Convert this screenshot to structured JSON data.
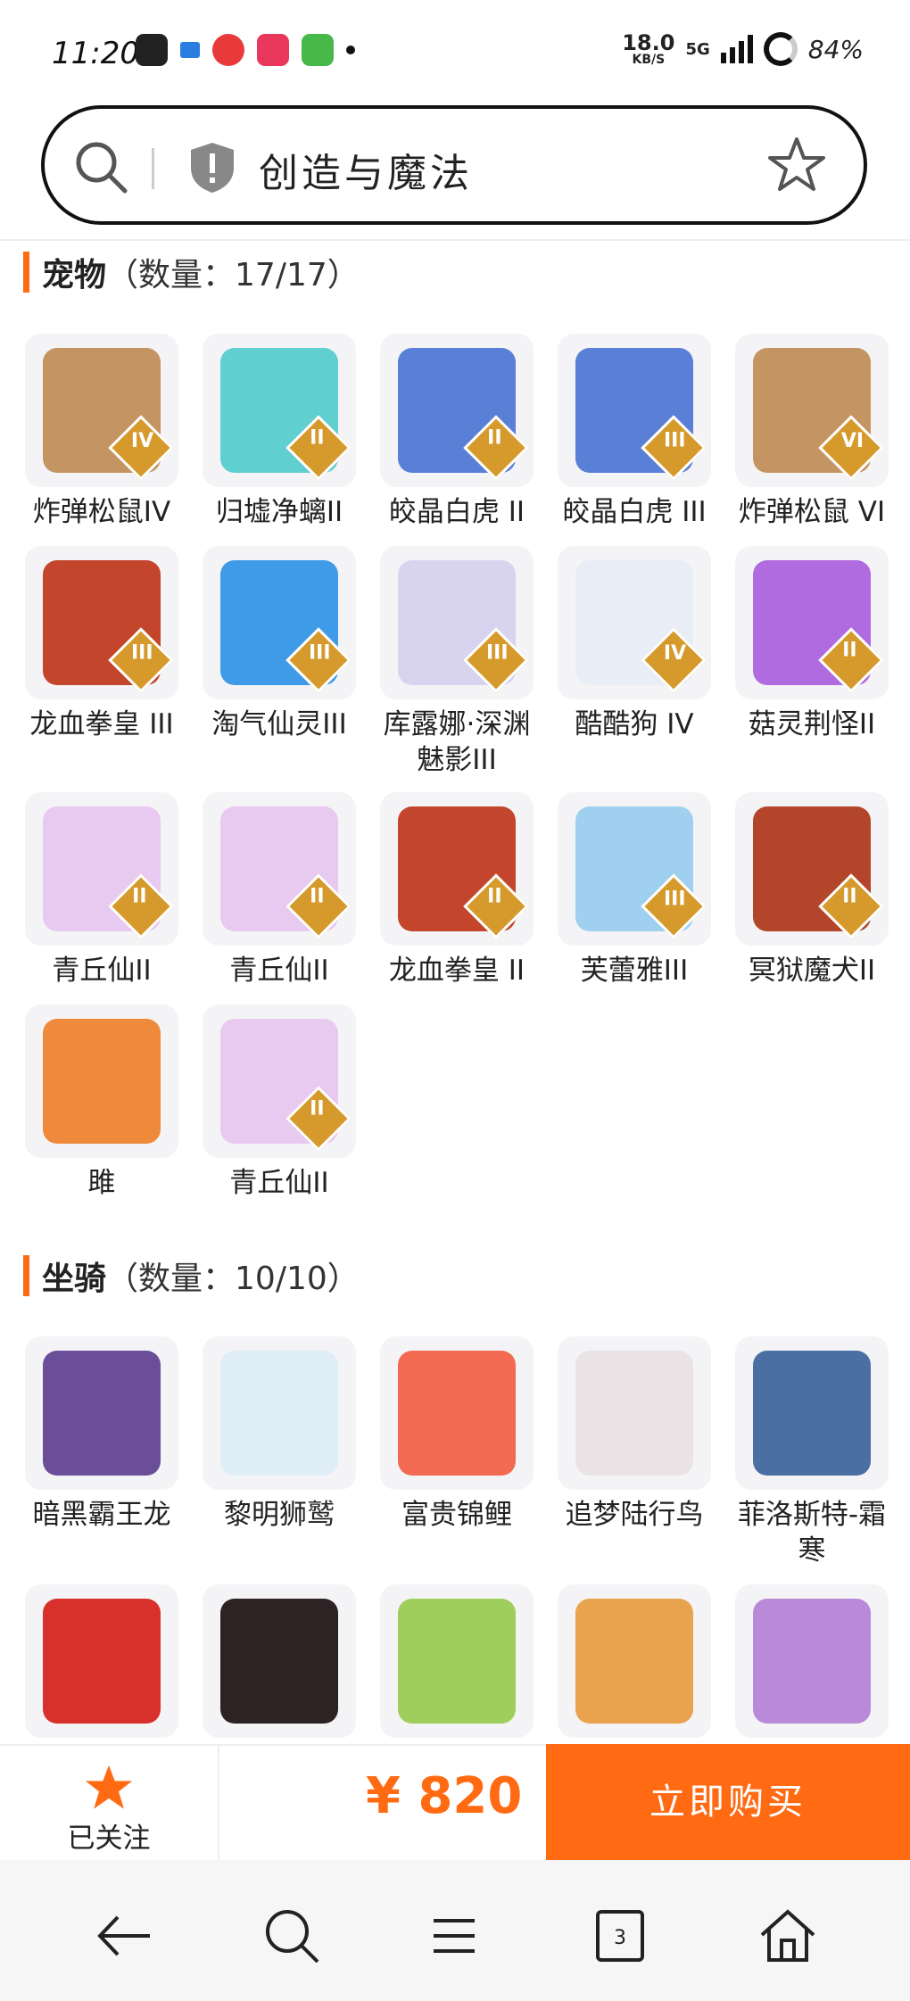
{
  "status_bar": {
    "time": "11:20",
    "speed_value": "18.0",
    "speed_unit": "KB/S",
    "network": "5G",
    "battery": "84%"
  },
  "search": {
    "query": "创造与魔法"
  },
  "pets_section": {
    "title": "宠物",
    "count": "（数量：17/17）",
    "items": [
      {
        "label": "炸弹松鼠IV",
        "badge": "IV",
        "color": "#c59463"
      },
      {
        "label": "归墟净螭II",
        "badge": "II",
        "color": "#5fcfcf"
      },
      {
        "label": "皎晶白虎 II",
        "badge": "II",
        "color": "#5a7fd6"
      },
      {
        "label": "皎晶白虎 III",
        "badge": "III",
        "color": "#5a7fd6"
      },
      {
        "label": "炸弹松鼠 VI",
        "badge": "VI",
        "color": "#c59463"
      },
      {
        "label": "龙血拳皇 III",
        "badge": "III",
        "color": "#c2452c"
      },
      {
        "label": "淘气仙灵III",
        "badge": "III",
        "color": "#3f9be8"
      },
      {
        "label": "库露娜·深渊魅影III",
        "badge": "III",
        "color": "#d8d4ef"
      },
      {
        "label": "酷酷狗 IV",
        "badge": "IV",
        "color": "#e9eef6"
      },
      {
        "label": "菇灵荆怪II",
        "badge": "II",
        "color": "#b06be0"
      },
      {
        "label": "青丘仙II",
        "badge": "II",
        "color": "#e8c9ef"
      },
      {
        "label": "青丘仙II",
        "badge": "II",
        "color": "#e8c9ef"
      },
      {
        "label": "龙血拳皇 II",
        "badge": "II",
        "color": "#c2452c"
      },
      {
        "label": "芙蕾雅III",
        "badge": "III",
        "color": "#9fd0f0"
      },
      {
        "label": "冥狱魔犬II",
        "badge": "II",
        "color": "#b3452a"
      },
      {
        "label": "雎",
        "badge": "",
        "color": "#ef8a3c"
      },
      {
        "label": "青丘仙II",
        "badge": "II",
        "color": "#e8c9ef"
      }
    ]
  },
  "mounts_section": {
    "title": "坐骑",
    "count": "（数量：10/10）",
    "items": [
      {
        "label": "暗黑霸王龙",
        "color": "#6b4e9a"
      },
      {
        "label": "黎明狮鹫",
        "color": "#dfeef6"
      },
      {
        "label": "富贵锦鲤",
        "color": "#f26a52"
      },
      {
        "label": "追梦陆行鸟",
        "color": "#e9e3e6"
      },
      {
        "label": "菲洛斯特-霜寒",
        "color": "#4b6ea3"
      },
      {
        "label": "",
        "color": "#d8302b"
      },
      {
        "label": "",
        "color": "#2d2224"
      },
      {
        "label": "",
        "color": "#9fce5c"
      },
      {
        "label": "",
        "color": "#e9a34e"
      },
      {
        "label": "",
        "color": "#b88ad8"
      }
    ]
  },
  "action_bar": {
    "follow_label": "已关注",
    "price": "¥ 820",
    "buy_label": "立即购买"
  },
  "colors": {
    "accent": "#ff6a13"
  }
}
